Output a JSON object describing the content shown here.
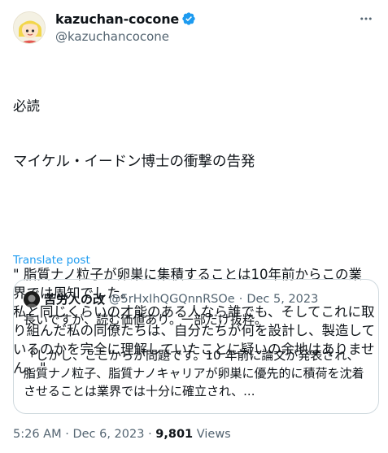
{
  "author": {
    "display_name": "kazuchan-cocone",
    "handle": "@kazuchancocone",
    "verified_icon": "verified-badge-icon",
    "verified_color": "#1d9bf0"
  },
  "more_icon": "more-options-icon",
  "post": {
    "line1": "必読",
    "line2": "マイケル・イードン博士の衝撃の告発",
    "paragraph": "\" 脂質ナノ粒子が卵巣に集積することは10年前からこの業界では周知でした。\n私と同じくらいの才能のある人なら誰でも、そしてこれに取り組んだ私の同僚たちは、自分たちが何を設計し、製造しているのかを完全に理解していたことに疑いの余地はありません。\""
  },
  "translate_label": "Translate post",
  "quote": {
    "name": "苦労人の改",
    "handle": "@5rHxIhQGQnnRSOe",
    "separator": "·",
    "date": "Dec 5, 2023",
    "text": "長いですが、読む価値あり。一部だけ抜粋。\n\n「しかし、ここからが問題です。10 年前に論文が発表され、脂質ナノ粒子、脂質ナノキャリアが卵巣に優先的に積荷を沈着させることは業界では十分に確立され、..."
  },
  "footer": {
    "time": "5:26 AM",
    "separator": "·",
    "date": "Dec 6, 2023",
    "separator2": "·",
    "views_count": "9,801",
    "views_label": "Views"
  },
  "colors": {
    "accent": "#1d9bf0",
    "secondary_text": "#536471",
    "border": "#cfd9de"
  }
}
